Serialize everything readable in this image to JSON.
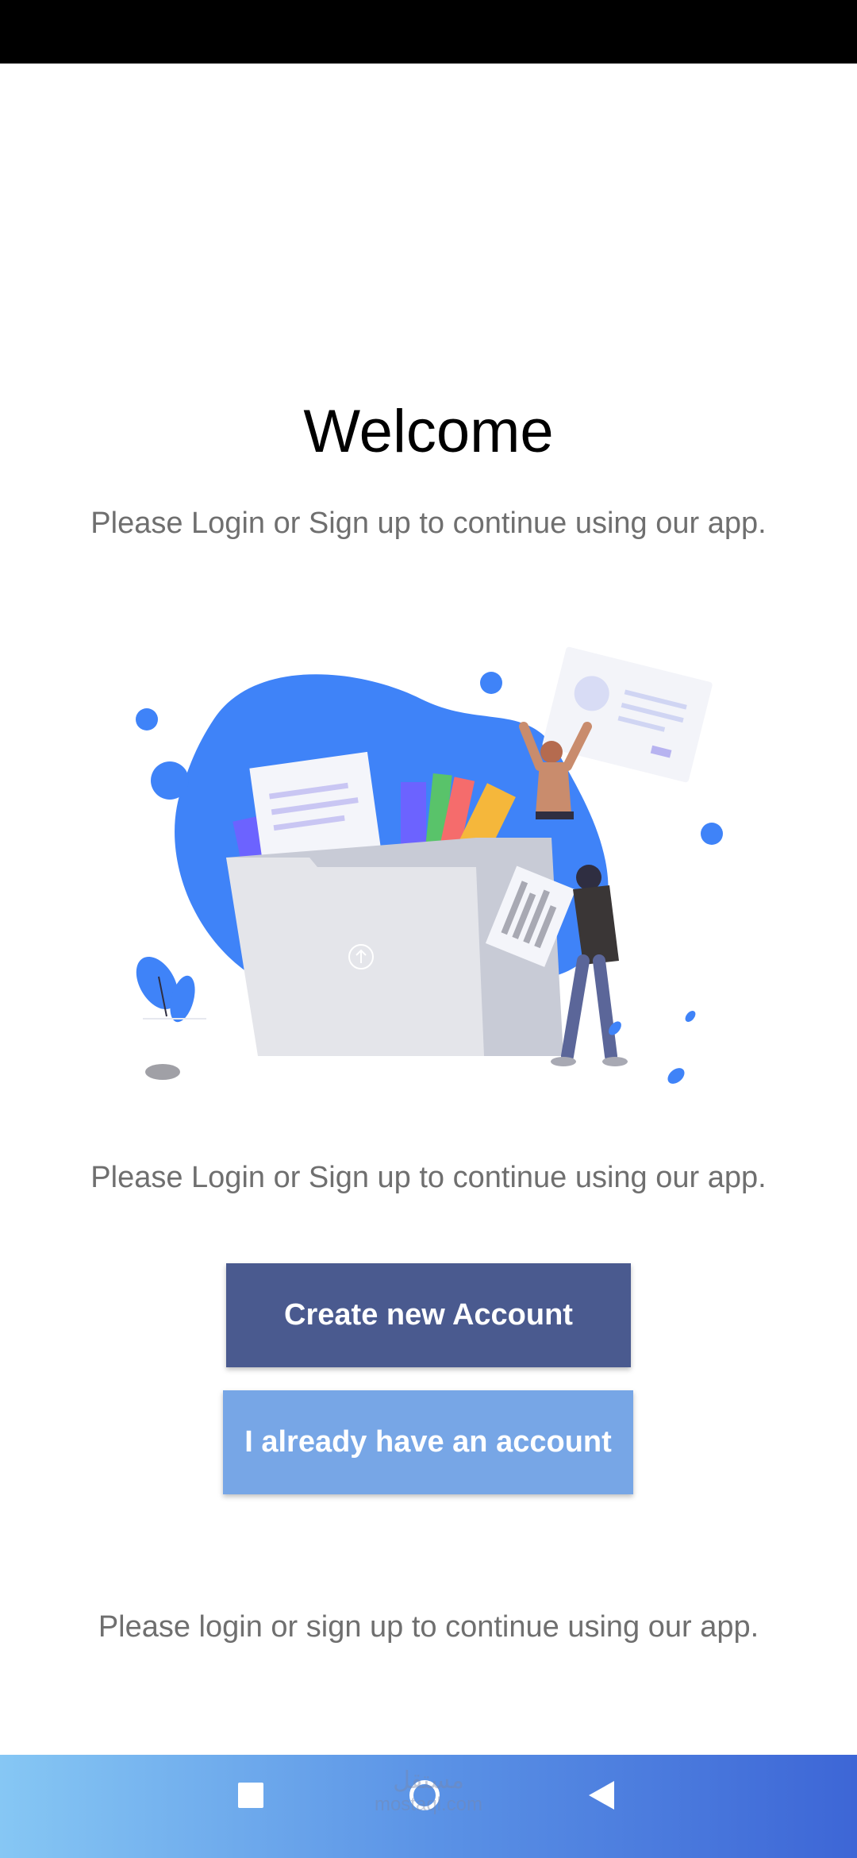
{
  "welcome": {
    "title": "Welcome",
    "subtitle_top": "Please Login or Sign up to continue using our app.",
    "subtitle_middle": "Please Login or Sign up to continue using our app.",
    "footer_text": "Please login or sign up to continue using our app."
  },
  "buttons": {
    "create_account": "Create new Account",
    "have_account": "I already have an account"
  },
  "navbar": {
    "recent_icon": "square-icon",
    "home_icon": "circle-icon",
    "back_icon": "triangle-back-icon"
  },
  "watermark": {
    "arabic": "مستقل",
    "latin": "mostaql.com"
  },
  "colors": {
    "primary_button": "#4a5a8f",
    "secondary_button": "#77a6e6",
    "illustration_blue": "#3f83f8"
  }
}
